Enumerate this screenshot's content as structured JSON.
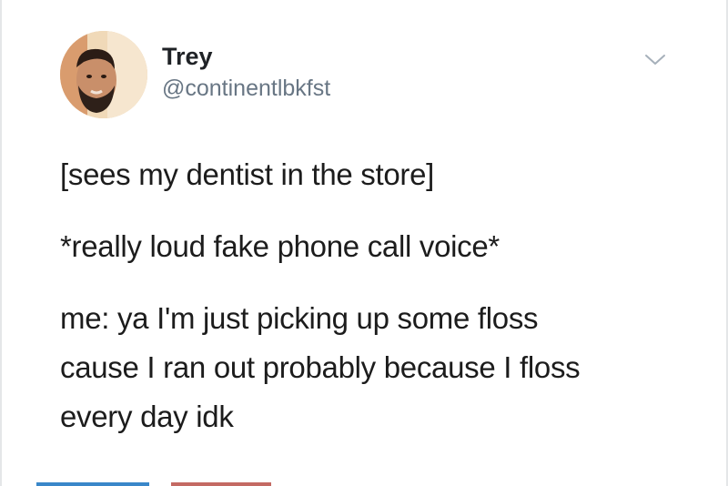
{
  "tweet": {
    "author": {
      "display_name": "Trey",
      "handle": "@continentlbkfst"
    },
    "lines": [
      "[sees my dentist in the store]",
      "*really loud fake phone call voice*",
      "me: ya I'm just picking up some floss",
      "cause I ran out probably because I floss",
      "every day idk"
    ]
  },
  "icons": {
    "more": "chevron-down-icon",
    "avatar": "profile-photo"
  },
  "colors": {
    "handle": "#687684",
    "text": "#1c1c1c",
    "footer_blue": "#3a87c9",
    "footer_red": "#c46a63"
  }
}
